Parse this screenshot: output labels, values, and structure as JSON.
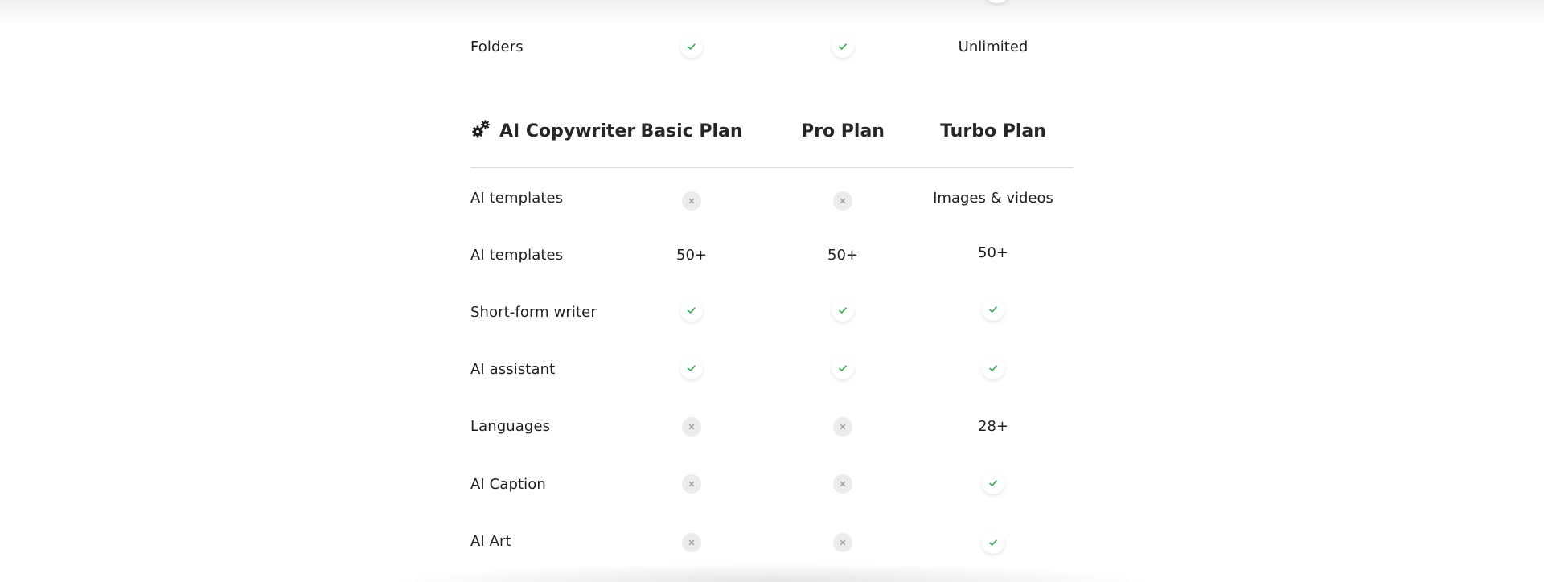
{
  "top_row": {
    "label": "Folders",
    "basic": "check",
    "pro": "check",
    "turbo": "Unlimited"
  },
  "section": {
    "title": "AI Copywriter",
    "icon": "gears-icon",
    "columns": [
      "Basic Plan",
      "Pro Plan",
      "Turbo Plan"
    ]
  },
  "rows": [
    {
      "label": "AI templates",
      "basic": "cross",
      "pro": "cross",
      "turbo": "Images & videos"
    },
    {
      "label": "AI templates",
      "basic": "50+",
      "pro": "50+",
      "turbo": "50+"
    },
    {
      "label": "Short-form writer",
      "basic": "check",
      "pro": "check",
      "turbo": "check"
    },
    {
      "label": "AI assistant",
      "basic": "check",
      "pro": "check",
      "turbo": "check"
    },
    {
      "label": "Languages",
      "basic": "cross",
      "pro": "cross",
      "turbo": "28+"
    },
    {
      "label": "AI Caption",
      "basic": "cross",
      "pro": "cross",
      "turbo": "check"
    },
    {
      "label": "AI Art",
      "basic": "cross",
      "pro": "cross",
      "turbo": "check"
    }
  ],
  "colors": {
    "check": "#2faa4f",
    "cross": "#9a9a9a",
    "cross_bg": "#ececec",
    "divider": "#dcdcdc",
    "text": "#1f1f1f"
  }
}
